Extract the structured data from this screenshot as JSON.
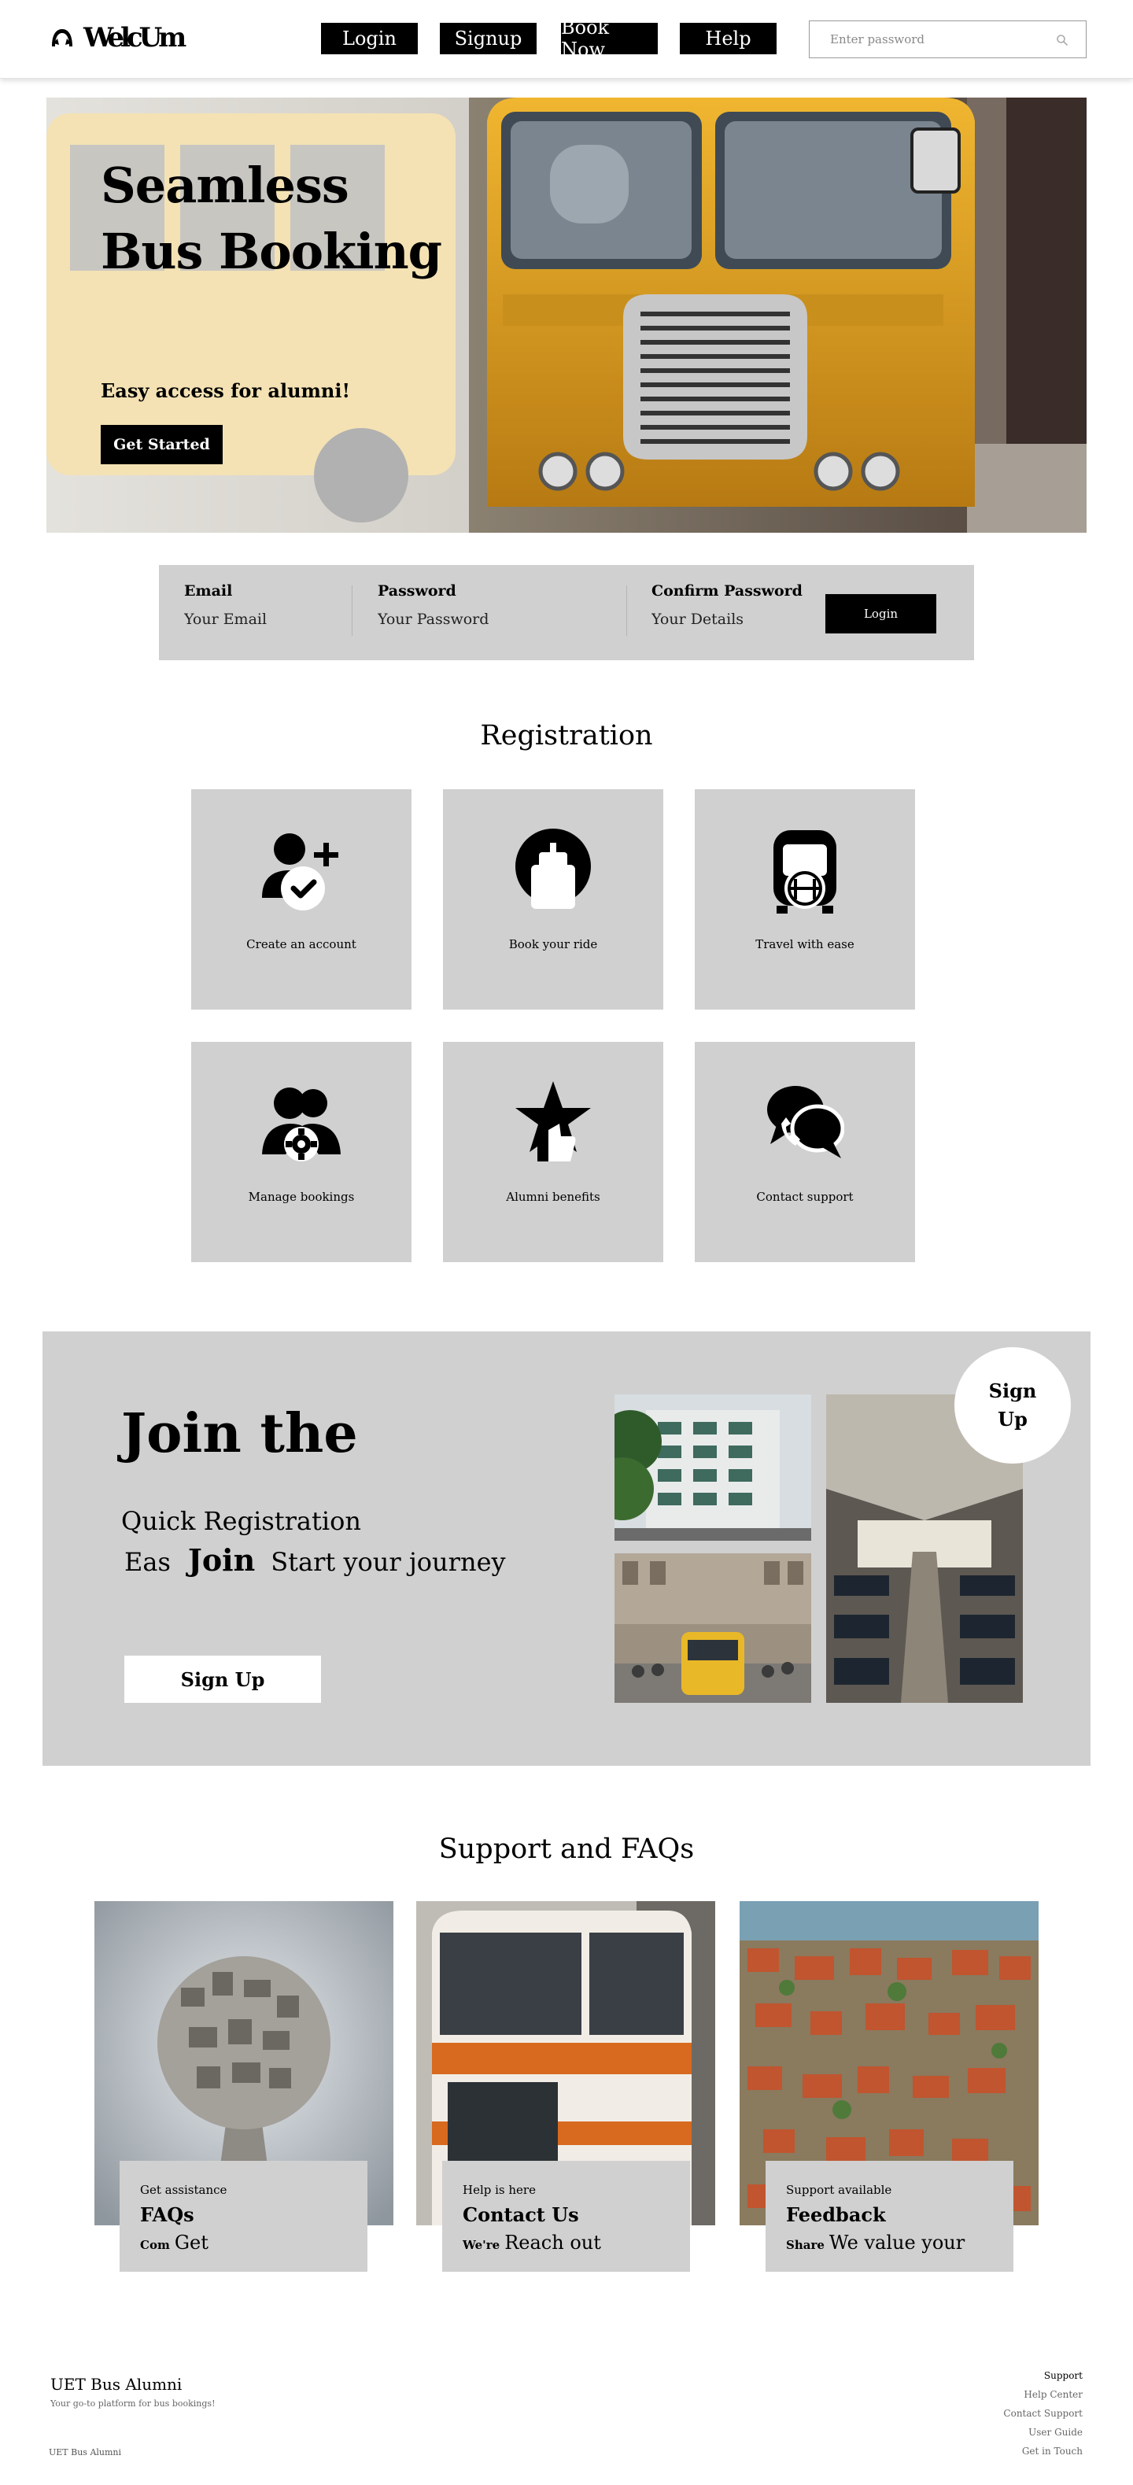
{
  "header": {
    "logo_text": "WelcUm",
    "nav": [
      "Login",
      "Signup",
      "Book Now",
      "Help"
    ],
    "search_placeholder": "Enter password"
  },
  "hero": {
    "title": "Seamless Bus Booking",
    "subtitle": "Easy access for alumni!",
    "cta": "Get Started"
  },
  "login_strip": {
    "fields": [
      {
        "label": "Email",
        "placeholder": "Your Email"
      },
      {
        "label": "Password",
        "placeholder": "Your Password"
      },
      {
        "label": "Confirm Password",
        "placeholder": "Your Details"
      }
    ],
    "button": "Login"
  },
  "registration": {
    "title": "Registration",
    "tiles": [
      {
        "label": "Create an account",
        "icon": "user-add-icon"
      },
      {
        "label": "Book your ride",
        "icon": "booking-icon"
      },
      {
        "label": "Travel with ease",
        "icon": "bus-icon"
      },
      {
        "label": "Manage bookings",
        "icon": "group-settings-icon"
      },
      {
        "label": "Alumni benefits",
        "icon": "star-thumb-icon"
      },
      {
        "label": "Contact support",
        "icon": "chat-phone-icon"
      }
    ]
  },
  "join": {
    "title": "Join the",
    "quick": "Quick Registration",
    "line_a": "Eas",
    "line_b": "Join",
    "line_c": "Start your journey",
    "button": "Sign Up",
    "badge_line1": "Sign",
    "badge_line2": "Up"
  },
  "support": {
    "title": "Support and FAQs",
    "cards": [
      {
        "kicker": "Get assistance",
        "title": "FAQs",
        "small": "Com",
        "big": "Get"
      },
      {
        "kicker": "Help is here",
        "title": "Contact Us",
        "small": "We're",
        "big": "Reach out"
      },
      {
        "kicker": "Support available",
        "title": "Feedback",
        "small": "Share",
        "big": "We value your"
      }
    ]
  },
  "footer": {
    "brand": "UET Bus Alumni",
    "tagline": "Your go-to platform for bus bookings!",
    "copyright": "UET Bus Alumni",
    "links_head": "Support",
    "links": [
      "Help Center",
      "Contact Support",
      "User Guide",
      "Get in Touch"
    ]
  },
  "colors": {
    "primary": "#000000",
    "panel": "#d0d0d0",
    "bus_yellow": "#e3a21f"
  }
}
